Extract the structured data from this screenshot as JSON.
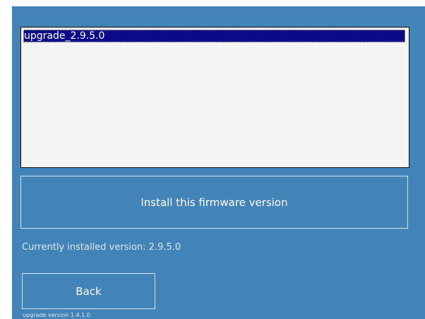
{
  "firmware_list": {
    "items": [
      {
        "label": "upgrade_2.9.5.0",
        "selected": true
      }
    ]
  },
  "actions": {
    "install_label": "Install this firmware version",
    "back_label": "Back"
  },
  "status": {
    "current_version": "Currently installed version: 2.9.5.0",
    "upgrade_version": "upgrade version 1.4.1.0"
  },
  "colors": {
    "background": "#4384b8",
    "list_background": "#f4f4f4",
    "selection": "#0b0b8a",
    "button_border": "#d6e3ee"
  }
}
